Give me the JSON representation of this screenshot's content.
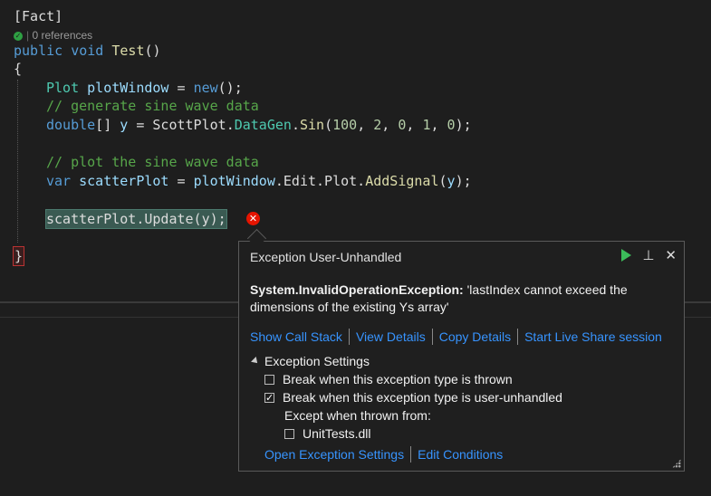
{
  "code": {
    "attribute": "[Fact]",
    "lens": "0 references",
    "lines": {
      "l1_kw1": "public",
      "l1_kw2": "void",
      "l1_fn": "Test",
      "l1_rest": "()",
      "open_brace": "{",
      "l3_type": "Plot",
      "l3_var": "plotWindow",
      "l3_eq": " = ",
      "l3_new": "new",
      "l3_end": "();",
      "c1": "// generate sine wave data",
      "l5_type": "double",
      "l5_a": "[] ",
      "l5_var": "y",
      "l5_b": " = ",
      "l5_cls": "ScottPlot",
      "l5_dot1": ".",
      "l5_cls2": "DataGen",
      "l5_dot2": ".",
      "l5_fn": "Sin",
      "l5_p1": "(",
      "l5_args": [
        "100",
        "2",
        "0",
        "1",
        "0"
      ],
      "l5_end": ");",
      "c2": "// plot the sine wave data",
      "l8_kw": "var",
      "l8_var": "scatterPlot",
      "l8_b": " = ",
      "l8_obj": "plotWindow",
      "l8_c": ".Edit.Plot.",
      "l8_fn": "AddSignal",
      "l8_p": "(",
      "l8_arg": "y",
      "l8_end": ");",
      "l10": "scatterPlot.Update(y);",
      "close_brace": "}"
    }
  },
  "error_marker": "✕",
  "popup": {
    "title": "Exception User-Unhandled",
    "exception_type": "System.InvalidOperationException:",
    "exception_message": " 'lastIndex cannot exceed the dimensions of the existing Ys array'",
    "links": [
      "Show Call Stack",
      "View Details",
      "Copy Details",
      "Start Live Share session"
    ],
    "settings_header": "Exception Settings",
    "opt_thrown": "Break when this exception type is thrown",
    "opt_thrown_checked": false,
    "opt_unhandled": "Break when this exception type is user-unhandled",
    "opt_unhandled_checked": true,
    "except_label": "Except when thrown from:",
    "opt_module": "UnitTests.dll",
    "opt_module_checked": false,
    "bottom_links": [
      "Open Exception Settings",
      "Edit Conditions"
    ]
  },
  "colors": {
    "keyword": "#569cd6",
    "type": "#4ec9b0",
    "method": "#dcdcaa",
    "comment": "#57a64a",
    "number": "#b5cea8",
    "link": "#3794ff",
    "error": "#e51400",
    "continue": "#3cbc5a"
  }
}
